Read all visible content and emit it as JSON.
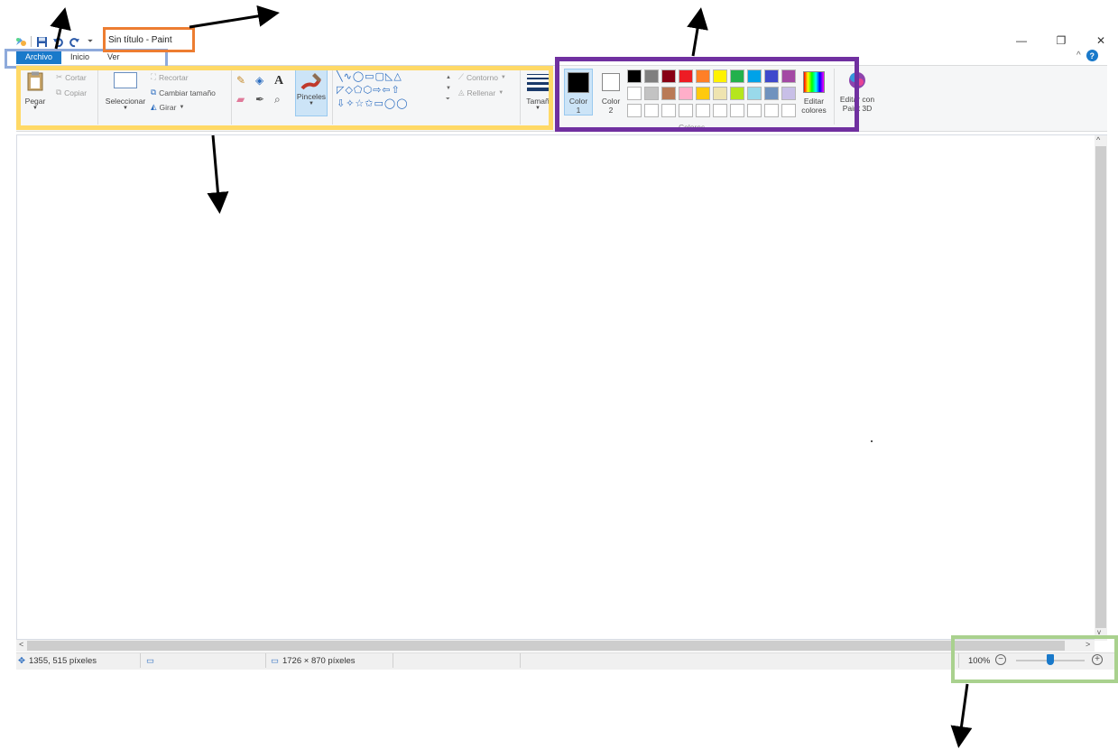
{
  "window": {
    "title": "Sin título - Paint",
    "minimize_glyph": "—",
    "maximize_glyph": "❐",
    "close_glyph": "✕",
    "collapse_glyph": "^",
    "help_glyph": "?"
  },
  "menu": {
    "tabs": [
      "Archivo",
      "Inicio",
      "Ver"
    ]
  },
  "ribbon": {
    "clipboard": {
      "paste": "Pegar",
      "cut": "Cortar",
      "copy": "Copiar"
    },
    "image": {
      "select": "Seleccionar",
      "crop": "Recortar",
      "resize": "Cambiar tamaño",
      "rotate": "Girar"
    },
    "tools": {
      "brushes": "Pinceles",
      "text_glyph": "A"
    },
    "shapes": {
      "row1": "╲∿◯▭▢◺△",
      "row2": "◸◇⬠⬡⇨⇦⇧",
      "row3": "⇩✧☆✩▭◯◯",
      "outline": "Contorno",
      "fill": "Rellenar"
    },
    "size": {
      "label": "Tamañ"
    },
    "colors": {
      "color1": {
        "label1": "Color",
        "label2": "1",
        "value": "#000000"
      },
      "color2": {
        "label1": "Color",
        "label2": "2",
        "value": "#ffffff"
      },
      "palette": [
        "#000000",
        "#7f7f7f",
        "#880015",
        "#ed1c24",
        "#ff7f27",
        "#fff200",
        "#22b14c",
        "#00a2e8",
        "#3f48cc",
        "#a349a4",
        "#ffffff",
        "#c3c3c3",
        "#b97a57",
        "#ffaec9",
        "#ffc90e",
        "#efe4b0",
        "#b5e61d",
        "#99d9ea",
        "#7092be",
        "#c8bfe7",
        "#ffffff",
        "#ffffff",
        "#ffffff",
        "#ffffff",
        "#ffffff",
        "#ffffff",
        "#ffffff",
        "#ffffff",
        "#ffffff",
        "#ffffff"
      ],
      "edit_colors_1": "Editar",
      "edit_colors_2": "colores",
      "edit_3d_1": "Editar con",
      "edit_3d_2": "Paint 3D",
      "group_label": "Colores"
    }
  },
  "status": {
    "cursor_position": "1355, 515 píxeles",
    "canvas_size": "1726 × 870 píxeles",
    "zoom": "100%",
    "zoom_level_percent": 100
  },
  "scroll": {
    "up": "^",
    "down": "v",
    "left": "<",
    "right": ">"
  },
  "annotation_colors": {
    "menu_box": "#8eaadb",
    "title_box": "#ed7d31",
    "ribbon_box": "#ffd966",
    "colors_box": "#7030a0",
    "zoom_box": "#a9d18e",
    "arrow": "#000000"
  }
}
